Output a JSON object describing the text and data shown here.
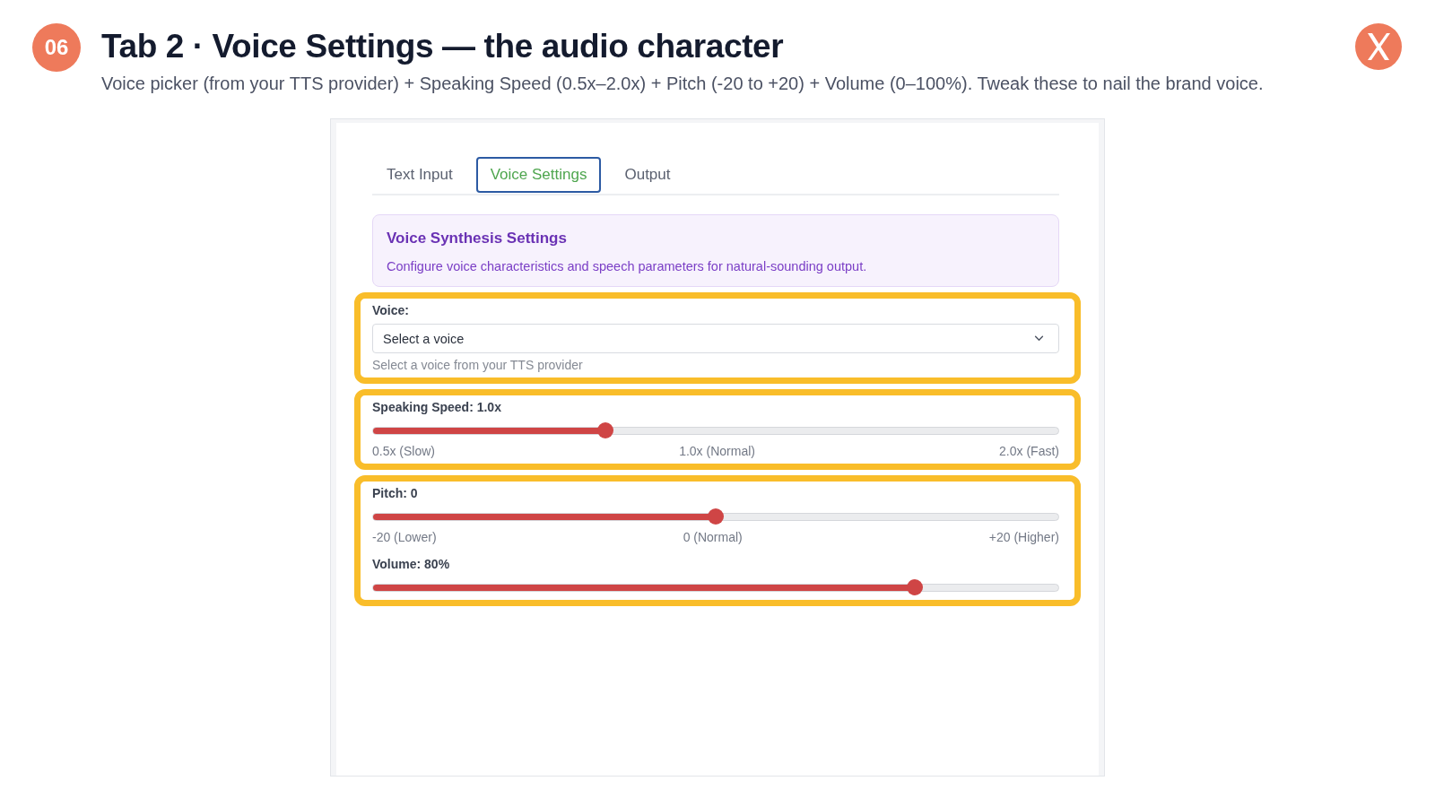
{
  "slide": {
    "number": "06",
    "title": "Tab 2 · Voice Settings — the audio character",
    "subtitle": "Voice picker (from your TTS provider) + Speaking Speed (0.5x–2.0x) + Pitch (-20 to +20) + Volume (0–100%). Tweak these to nail the brand voice."
  },
  "tabs": [
    {
      "label": "Text Input",
      "selected": false
    },
    {
      "label": "Voice Settings",
      "selected": true
    },
    {
      "label": "Output",
      "selected": false
    }
  ],
  "info_box": {
    "title": "Voice Synthesis Settings",
    "description": "Configure voice characteristics and speech parameters for natural-sounding output."
  },
  "highlight_groups": [
    {
      "fields": [
        {
          "kind": "select",
          "label": "Voice:",
          "selected_option": "Select a voice",
          "hint": "Select a voice from your TTS provider"
        }
      ]
    },
    {
      "fields": [
        {
          "kind": "slider",
          "label": "Speaking Speed: 1.0x",
          "level": 0.34,
          "scale": [
            "0.5x (Slow)",
            "1.0x (Normal)",
            "2.0x (Fast)"
          ]
        }
      ]
    },
    {
      "fields": [
        {
          "kind": "slider",
          "label": "Pitch: 0",
          "level": 0.5,
          "scale": [
            "-20 (Lower)",
            "0 (Normal)",
            "+20 (Higher)"
          ]
        },
        {
          "kind": "slider",
          "label": "Volume: 80%",
          "level": 0.79
        }
      ]
    }
  ]
}
